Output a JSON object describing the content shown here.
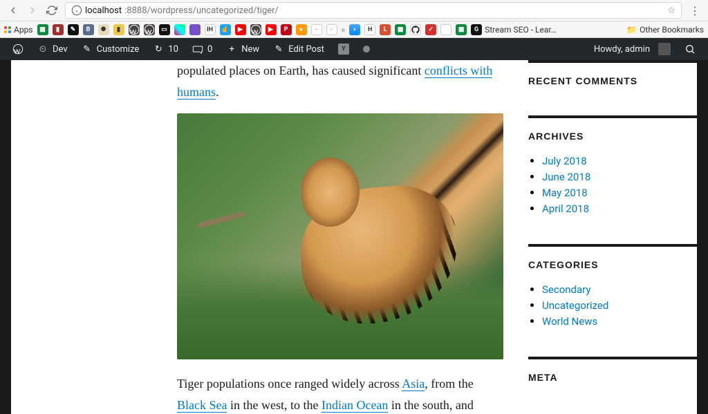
{
  "browser": {
    "url_host": "localhost",
    "url_port_path": ":8888/wordpress/uncategorized/tiger/"
  },
  "bookmarks": {
    "apps_label": "Apps",
    "stream_seo": "Stream SEO - Lear…",
    "other_label": "Other Bookmarks"
  },
  "wpbar": {
    "site": "Dev",
    "customize": "Customize",
    "updates_count": "10",
    "comments_count": "0",
    "new_label": "New",
    "edit_label": "Edit Post",
    "howdy": "Howdy, admin"
  },
  "article": {
    "p1_pre": "populated places on Earth, has caused significant ",
    "p1_link": "conflicts with humans",
    "p1_post": ".",
    "p2_a": "Tiger populations once ranged widely across ",
    "p2_asia": "Asia",
    "p2_b": ", from the ",
    "p2_black": "Black Sea",
    "p2_c": " in the west, to the ",
    "p2_indian": "Indian Ocean",
    "p2_d": " in the south, and"
  },
  "widgets": {
    "recent_comments": "Recent Comments",
    "archives": "Archives",
    "archive_items": [
      "July 2018",
      "June 2018",
      "May 2018",
      "April 2018"
    ],
    "categories": "Categories",
    "category_items": [
      "Secondary",
      "Uncategorized",
      "World News"
    ],
    "meta": "Meta"
  }
}
